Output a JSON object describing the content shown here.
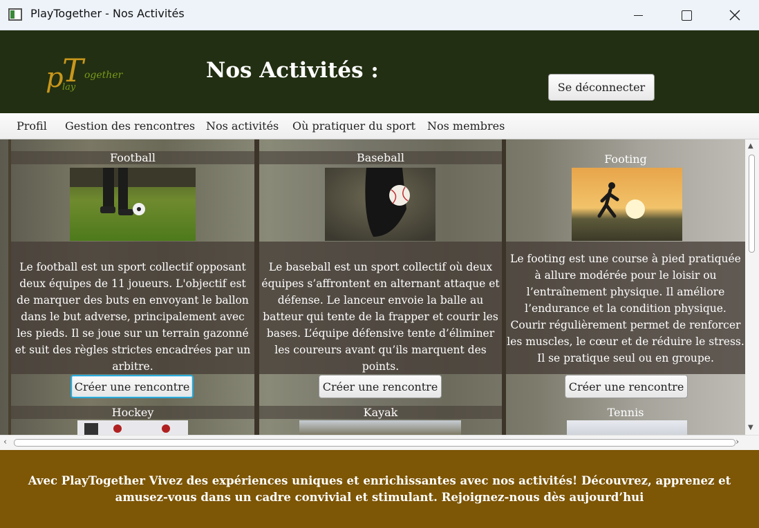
{
  "window": {
    "title": "PlayTogether - Nos Activités",
    "icon": "app-window-icon"
  },
  "header": {
    "logo_text": "PlayTogether",
    "title": "Nos Activités :",
    "logout_label": "Se déconnecter"
  },
  "menu": {
    "items": [
      {
        "label": "Profil"
      },
      {
        "label": "Gestion des rencontres"
      },
      {
        "label": "Nos activités"
      },
      {
        "label": "Où pratiquer du sport"
      },
      {
        "label": "Nos membres"
      }
    ]
  },
  "activities": [
    {
      "name": "Football",
      "description": "Le football est un sport collectif opposant deux équipes de 11 joueurs. L'objectif est de marquer des buts en envoyant le ballon dans le but adverse, principalement avec les pieds. Il se joue sur un terrain gazonné et suit des règles strictes encadrées par un arbitre.",
      "button": "Créer une rencontre"
    },
    {
      "name": "Baseball",
      "description": "Le baseball est un sport collectif où deux équipes s’affrontent en alternant attaque et défense. Le lanceur envoie la balle au batteur qui tente de la frapper et courir les bases. L’équipe défensive tente d’éliminer les coureurs avant qu’ils marquent des points.",
      "button": "Créer une rencontre"
    },
    {
      "name": "Footing",
      "description": "Le footing est une course à pied pratiquée à allure modérée pour le loisir ou l’entraînement physique. Il améliore l’endurance et la condition physique. Courir régulièrement permet de renforcer les muscles, le cœur et de réduire le stress. Il se pratique seul ou en groupe.",
      "button": "Créer une rencontre"
    },
    {
      "name": "Hockey"
    },
    {
      "name": "Kayak"
    },
    {
      "name": "Tennis"
    }
  ],
  "footer": {
    "text": "Avec PlayTogether Vivez des expériences uniques et enrichissantes avec nos activités! Découvrez, apprenez et amusez-vous dans un cadre convivial et stimulant. Rejoignez-nous dès aujourd’hui"
  },
  "colors": {
    "header_bg": "#222f12",
    "footer_bg": "#7d5606",
    "focus_ring": "#2aa7d6",
    "logo_orange": "#c9971c",
    "logo_green": "#7a9a1a"
  }
}
